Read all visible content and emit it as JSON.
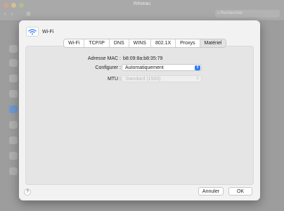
{
  "window": {
    "title": "Réseau",
    "back_glyph": "‹",
    "forward_glyph": "›",
    "grid_glyph": "⊞",
    "search_placeholder": "Rechercher"
  },
  "sheet": {
    "title": "Wi-Fi",
    "icon": "wifi-icon",
    "tabs": [
      {
        "label": "Wi-Fi"
      },
      {
        "label": "TCP/IP"
      },
      {
        "label": "DNS"
      },
      {
        "label": "WINS"
      },
      {
        "label": "802.1X"
      },
      {
        "label": "Proxys"
      },
      {
        "label": "Matériel"
      }
    ],
    "active_tab": "Matériel",
    "fields": {
      "mac_label": "Adresse MAC :",
      "mac_value": "b8:09:8a:b8:35:79",
      "configure_label": "Configurer :",
      "configure_value": "Automatiquement",
      "mtu_label": "MTU :",
      "mtu_value": "Standard  (1500)"
    },
    "help_label": "?",
    "cancel_label": "Annuler",
    "ok_label": "OK"
  },
  "colors": {
    "accent": "#2f7cf6"
  }
}
